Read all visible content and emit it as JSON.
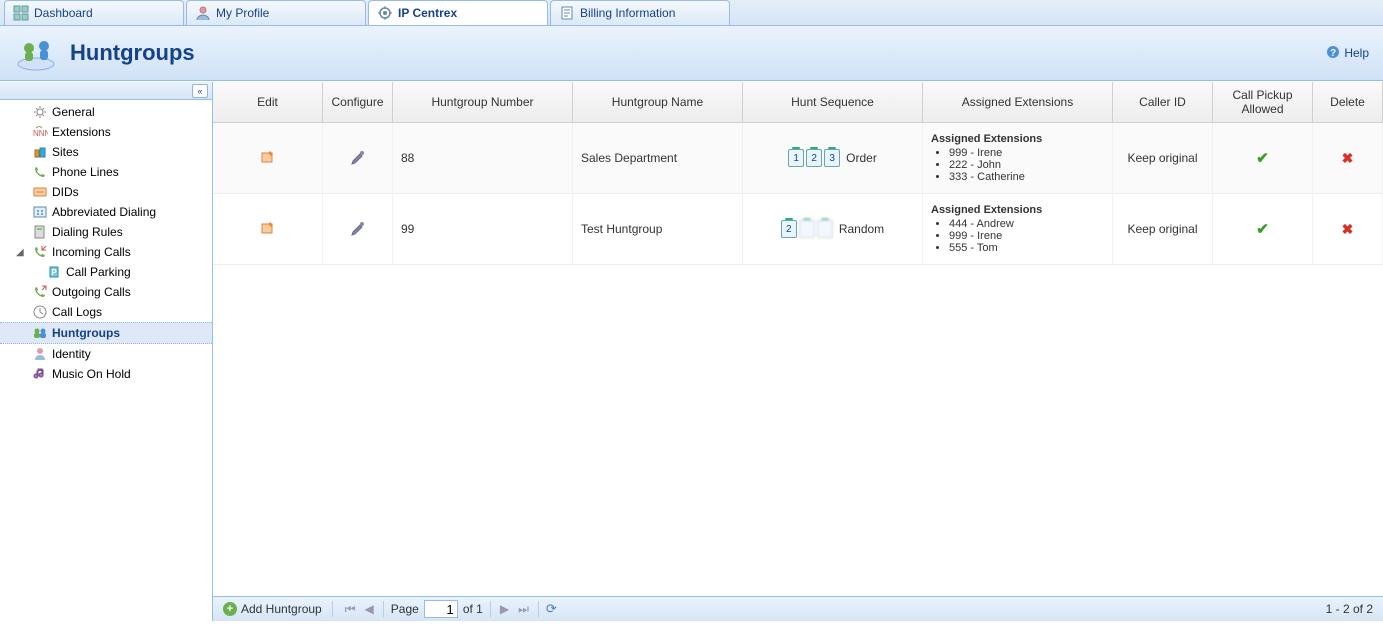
{
  "tabs": {
    "dashboard": "Dashboard",
    "my_profile": "My Profile",
    "ip_centrex": "IP Centrex",
    "billing_info": "Billing Information"
  },
  "header": {
    "title": "Huntgroups",
    "help": "Help"
  },
  "sidebar": {
    "items": [
      {
        "label": "General",
        "icon": "gear"
      },
      {
        "label": "Extensions",
        "icon": "extensions"
      },
      {
        "label": "Sites",
        "icon": "sites"
      },
      {
        "label": "Phone Lines",
        "icon": "phone-lines"
      },
      {
        "label": "DIDs",
        "icon": "dids"
      },
      {
        "label": "Abbreviated Dialing",
        "icon": "abbrev"
      },
      {
        "label": "Dialing Rules",
        "icon": "dialing"
      },
      {
        "label": "Incoming Calls",
        "icon": "incoming",
        "expanded": true
      },
      {
        "label": "Call Parking",
        "icon": "parking",
        "child": true
      },
      {
        "label": "Outgoing Calls",
        "icon": "outgoing"
      },
      {
        "label": "Call Logs",
        "icon": "logs"
      },
      {
        "label": "Huntgroups",
        "icon": "huntgroups",
        "selected": true
      },
      {
        "label": "Identity",
        "icon": "identity"
      },
      {
        "label": "Music On Hold",
        "icon": "music"
      }
    ]
  },
  "grid": {
    "columns": {
      "edit": "Edit",
      "configure": "Configure",
      "number": "Huntgroup Number",
      "name": "Huntgroup Name",
      "sequence": "Hunt Sequence",
      "extensions": "Assigned Extensions",
      "callerid": "Caller ID",
      "pickup": "Call Pickup Allowed",
      "delete": "Delete"
    },
    "ext_header": "Assigned Extensions",
    "rows": [
      {
        "number": "88",
        "name": "Sales Department",
        "sequence": "Order",
        "sequence_type": "order",
        "extensions": [
          "999 - Irene",
          "222 - John",
          "333 - Catherine"
        ],
        "callerid": "Keep original",
        "pickup": true
      },
      {
        "number": "99",
        "name": "Test Huntgroup",
        "sequence": "Random",
        "sequence_type": "random",
        "extensions": [
          "444 - Andrew",
          "999 - Irene",
          "555 - Tom"
        ],
        "callerid": "Keep original",
        "pickup": true
      }
    ]
  },
  "footer": {
    "add": "Add Huntgroup",
    "page_label": "Page",
    "page_value": "1",
    "of_label": "of 1",
    "display": "1 - 2 of 2"
  }
}
